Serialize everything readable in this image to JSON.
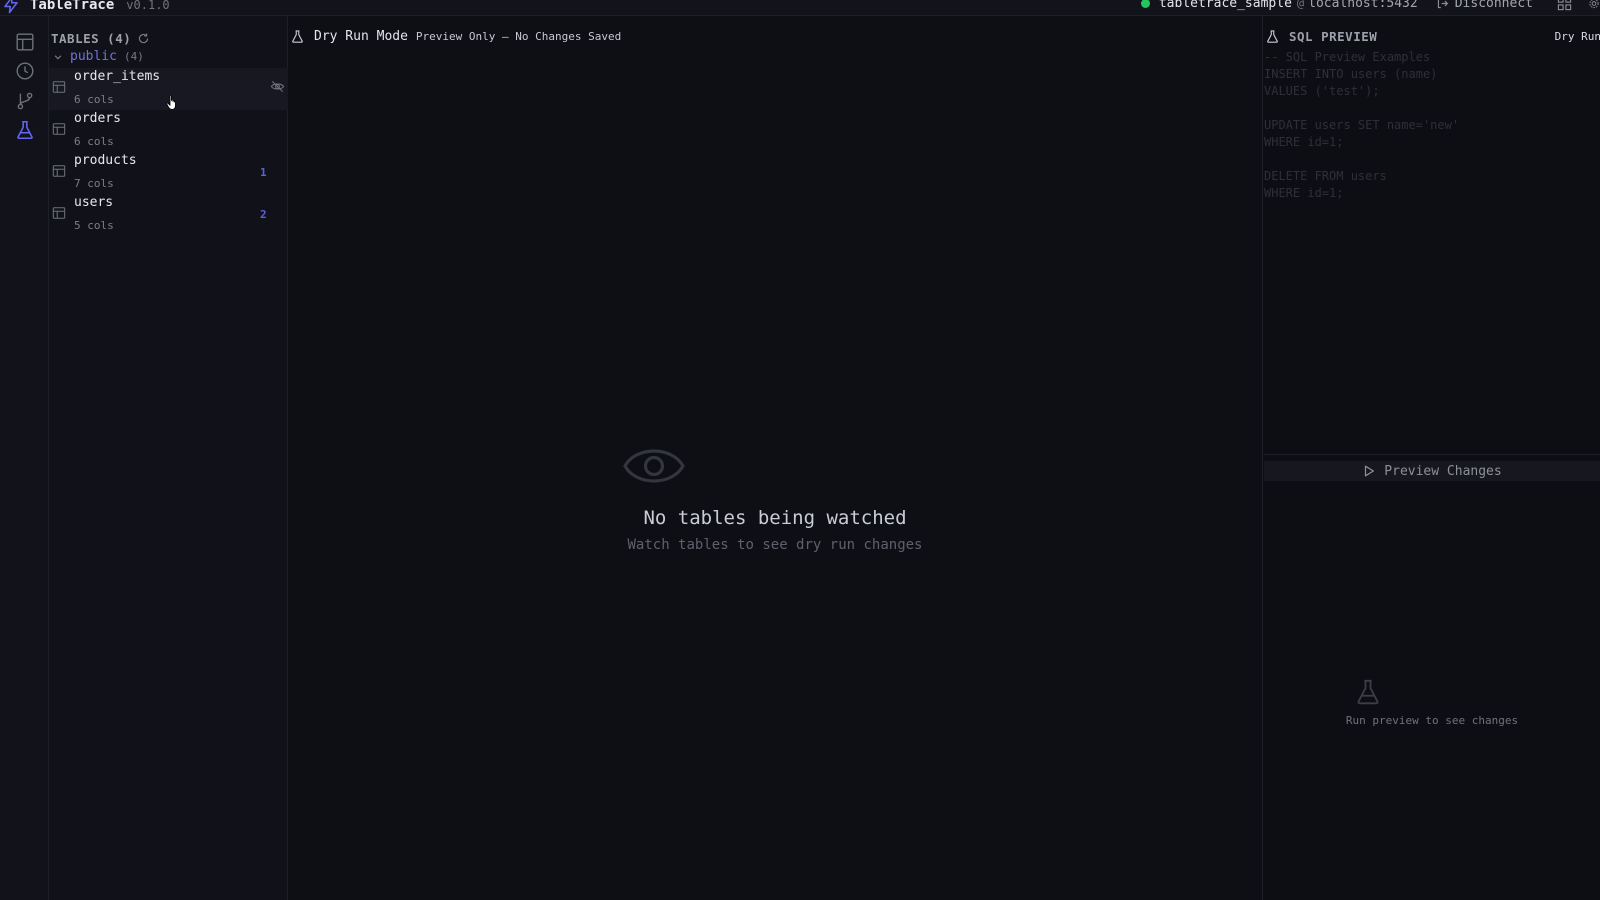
{
  "app": {
    "name": "TableTrace",
    "version": "v0.1.0"
  },
  "connection": {
    "database": "tabletrace_sample",
    "separator": "@",
    "host": "localhost:5432",
    "disconnect_label": "Disconnect",
    "status_color": "#22c55e"
  },
  "activity_bar": {
    "items": [
      {
        "icon": "table-grid-icon",
        "active": false
      },
      {
        "icon": "clock-icon",
        "active": false
      },
      {
        "icon": "git-branch-icon",
        "active": false
      },
      {
        "icon": "flask-icon",
        "active": true
      }
    ],
    "accent": "#6366f1"
  },
  "sidebar": {
    "title": "TABLES (4)",
    "schema": {
      "name": "public",
      "count": "(4)"
    },
    "tables": [
      {
        "name": "order_items",
        "cols": "6 cols",
        "badge": ""
      },
      {
        "name": "orders",
        "cols": "6 cols",
        "badge": ""
      },
      {
        "name": "products",
        "cols": "7 cols",
        "badge": "1"
      },
      {
        "name": "users",
        "cols": "5 cols",
        "badge": "2"
      }
    ]
  },
  "main": {
    "mode_title": "Dry Run Mode",
    "mode_subtitle": "Preview Only — No Changes Saved",
    "empty_title": "No tables being watched",
    "empty_subtitle": "Watch tables to see dry run changes"
  },
  "sql_panel": {
    "title": "SQL PREVIEW",
    "tag": "Dry Run",
    "lines": [
      "-- SQL Preview Examples",
      "INSERT INTO users (name)",
      "VALUES ('test');",
      "",
      "UPDATE users SET name='new'",
      "WHERE id=1;",
      "",
      "DELETE FROM users",
      "WHERE id=1;"
    ],
    "preview_button": "Preview Changes",
    "empty_text": "Run preview to see changes"
  }
}
